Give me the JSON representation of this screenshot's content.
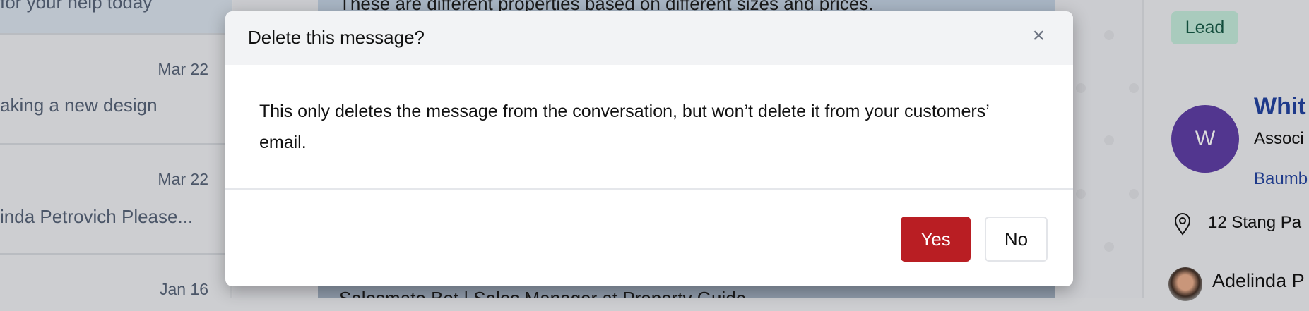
{
  "conversation_list": [
    {
      "date": "",
      "snippet": "for your help today"
    },
    {
      "date": "Mar 22",
      "snippet": "aking a new design"
    },
    {
      "date": "Mar 22",
      "snippet": "inda Petrovich Please..."
    },
    {
      "date": "Jan 16",
      "snippet": ""
    }
  ],
  "messages": {
    "top": "These are different properties based on different sizes and prices.",
    "bottom": "Salesmate Bot | Sales Manager at Property Guide"
  },
  "contact": {
    "badge": "Lead",
    "avatar_letter": "W",
    "name": "Whit",
    "title": "Associ",
    "company": "Baumb",
    "address": "12 Stang Pa",
    "owner": "Adelinda P",
    "colors": {
      "avatar": "#52368f",
      "badge_bg": "#a9cbbd",
      "link": "#1e3a8a"
    }
  },
  "dialog": {
    "title": "Delete this message?",
    "body": "This only deletes the message from the conversation, but won’t delete it from your customers’ email.",
    "yes": "Yes",
    "no": "No",
    "close_icon": "×",
    "yes_color": "#b91e23"
  }
}
